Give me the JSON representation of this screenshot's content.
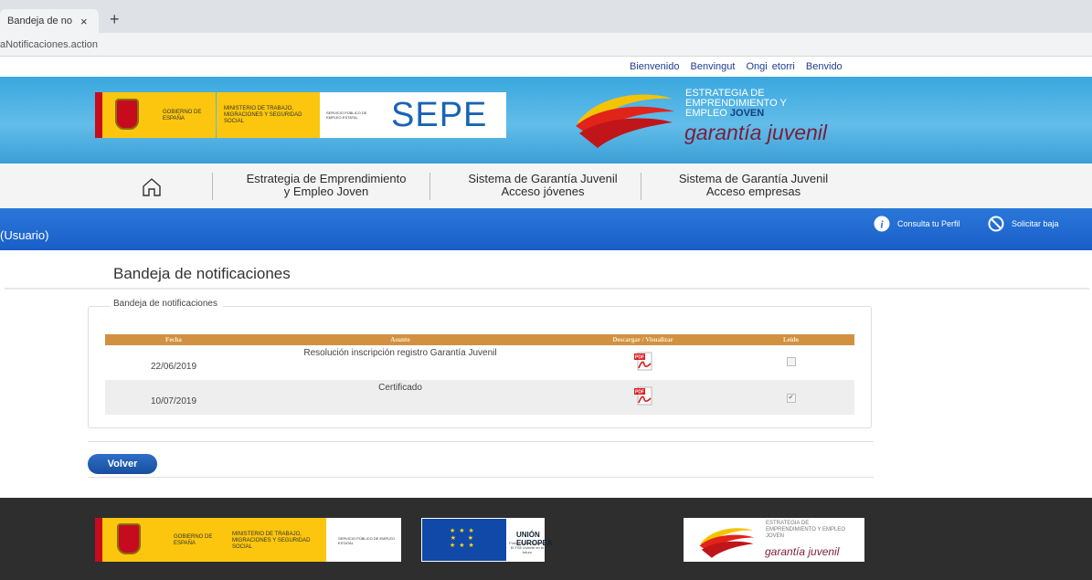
{
  "browser": {
    "tab_title": "Bandeja de no",
    "tab_close": "×",
    "new_tab": "+",
    "url": "aNotificaciones.action"
  },
  "welcome": {
    "links": [
      "Bienvenido",
      "Benvingut",
      "Ongi etorri",
      "Benvido"
    ]
  },
  "banner": {
    "gobierno": "GOBIERNO DE ESPAÑA",
    "ministerio": "MINISTERIO DE TRABAJO, MIGRACIONES Y SEGURIDAD SOCIAL",
    "servicio": "SERVICIO PÚBLICO DE EMPLEO ESTATAL",
    "sepe": "SEPE",
    "estrategia_line1": "ESTRATEGIA DE",
    "estrategia_line2": "EMPRENDIMIENTO Y",
    "estrategia_line3a": "EMPLEO",
    "estrategia_line3b": "JOVEN",
    "garantia": "garantía juvenil"
  },
  "nav": {
    "item1_line1": "Estrategia de Emprendimiento",
    "item1_line2": "y Empleo Joven",
    "item2_line1": "Sistema de Garantía Juvenil",
    "item2_line2": "Acceso jóvenes",
    "item3_line1": "Sistema de Garantía Juvenil",
    "item3_line2": "Acceso empresas"
  },
  "userbar": {
    "user": "(Usuario)",
    "profile_link": "Consulta tu Perfil",
    "unsubscribe_link": "Solicitar baja"
  },
  "main": {
    "title": "Bandeja de notificaciones",
    "legend": "Bandeja de notificaciones",
    "columns": [
      "Fecha",
      "Asunto",
      "Descargar / Visualizar",
      "Leído"
    ],
    "rows": [
      {
        "fecha": "22/06/2019",
        "asunto": "Resolución inscripción registro Garantía Juvenil",
        "leido": false
      },
      {
        "fecha": "10/07/2019",
        "asunto": "Certificado",
        "leido": true
      }
    ],
    "back_button": "Volver"
  },
  "footer": {
    "gobierno": "GOBIERNO DE ESPAÑA",
    "ministerio": "MINISTERIO DE TRABAJO, MIGRACIONES Y SEGURIDAD SOCIAL",
    "servicio": "SERVICIO PÚBLICO DE EMPLEO ESTATAL",
    "eu_title": "UNIÓN EUROPEA",
    "eu_subtitle": "Fondo Social Europeo El FSE invierte en tu futuro",
    "estrategia": "ESTRATEGIA DE EMPRENDIMIENTO Y EMPLEO JOVEN",
    "garantia": "garantía juvenil"
  },
  "colors": {
    "table_header": "#d19140",
    "userbar": "#1a5ec8",
    "button": "#174f9e"
  }
}
